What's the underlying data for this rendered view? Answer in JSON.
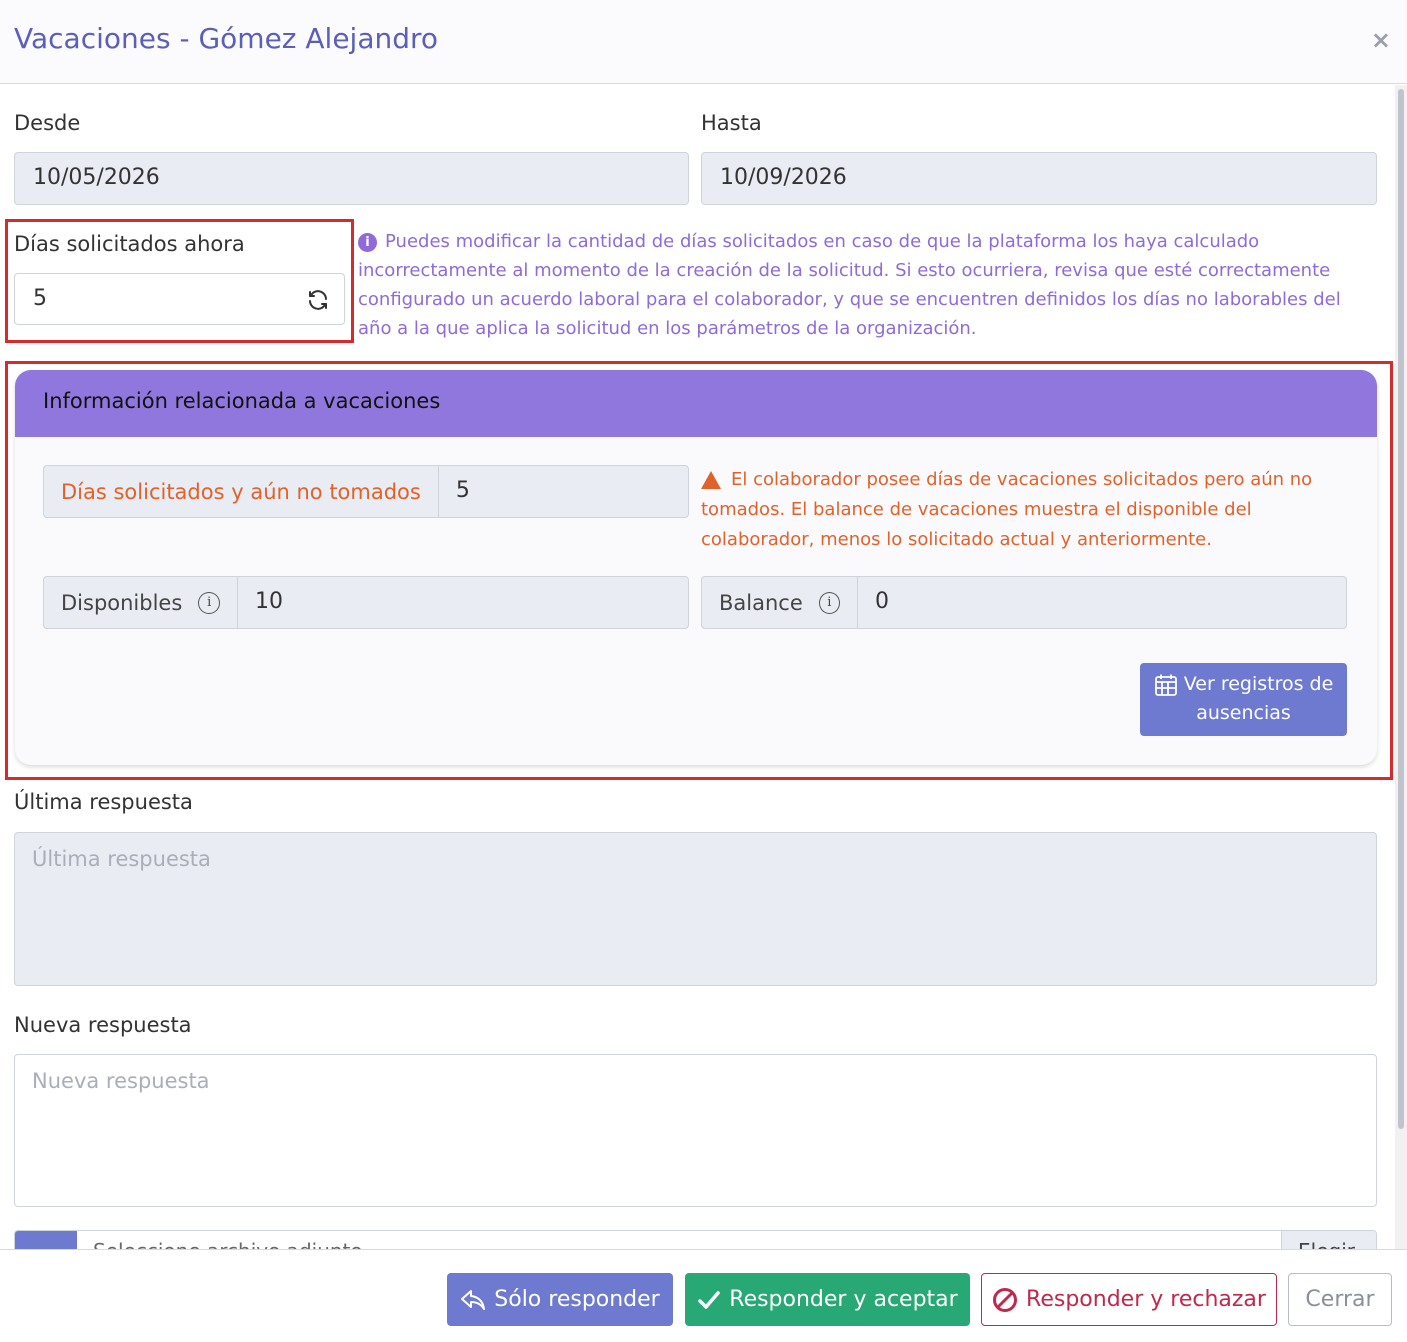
{
  "header": {
    "title": "Vacaciones - Gómez Alejandro",
    "close_label": "×"
  },
  "desde": {
    "label": "Desde",
    "value": "10/05/2026"
  },
  "hasta": {
    "label": "Hasta",
    "value": "10/09/2026"
  },
  "dias_ahora": {
    "label": "Días solicitados ahora",
    "value": "5"
  },
  "info_note": "Puedes modificar la cantidad de días solicitados en caso de que la plataforma los haya calculado incorrectamente al momento de la creación de la solicitud. Si esto ocurriera, revisa que esté correctamente configurado un acuerdo laboral para el colaborador, y que se encuentren definidos los días no laborables del año a la que aplica la solicitud en los parámetros de la organización.",
  "card": {
    "title": "Información relacionada a vacaciones",
    "no_tomados": {
      "label": "Días solicitados y aún no tomados",
      "value": "5"
    },
    "warning": "El colaborador posee días de vacaciones solicitados pero aún no tomados. El balance de vacaciones muestra el disponible del colaborador, menos lo solicitado actual y anteriormente.",
    "disponibles": {
      "label": "Disponibles",
      "value": "10"
    },
    "balance": {
      "label": "Balance",
      "value": "0"
    },
    "records_button": "Ver registros de ausencias"
  },
  "ultima": {
    "label": "Última respuesta",
    "placeholder": "Última respuesta"
  },
  "nueva": {
    "label": "Nueva respuesta",
    "placeholder": "Nueva respuesta"
  },
  "file": {
    "placeholder": "Seleccione archivo adjunto",
    "button": "Elegir"
  },
  "footer": {
    "solo_responder": "Sólo responder",
    "responder_aceptar": "Responder y aceptar",
    "responder_rechazar": "Responder y rechazar",
    "cerrar": "Cerrar"
  },
  "colors": {
    "primary": "#6d7ad0",
    "success": "#27a874",
    "danger": "#c0284d",
    "accent": "#9077de",
    "warning": "#e0622b"
  }
}
